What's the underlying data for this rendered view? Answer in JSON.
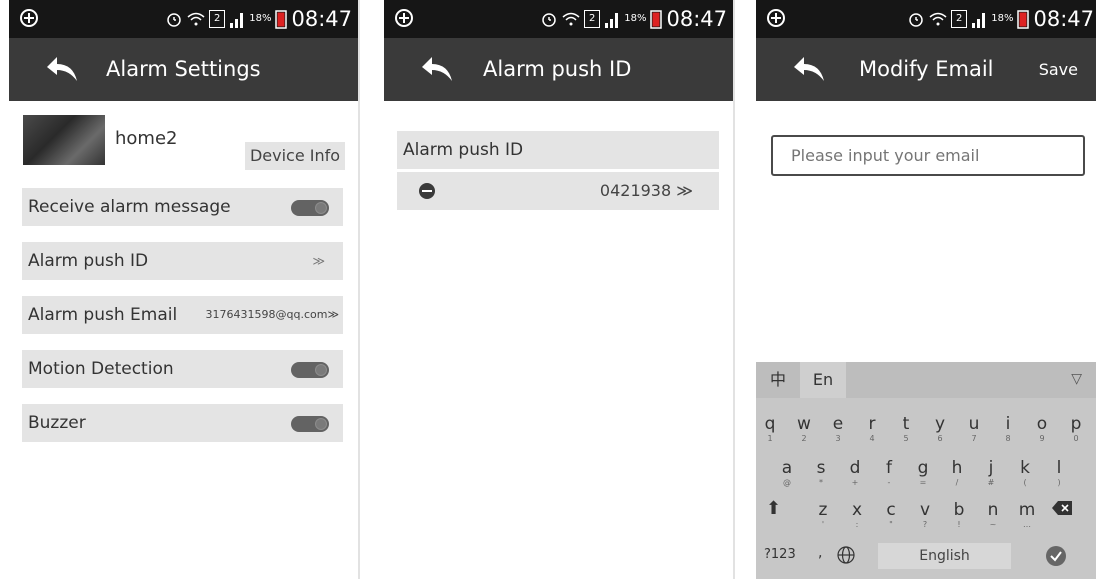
{
  "status_bar": {
    "battery": "18%",
    "time": "08:47",
    "sim": "2"
  },
  "screen1": {
    "title": "Alarm Settings",
    "device_name": "home2",
    "device_info_label": "Device Info",
    "rows": [
      {
        "label": "Receive alarm message",
        "toggle_on": true
      },
      {
        "label": "Alarm push ID",
        "value": "",
        "chevron": "≫"
      },
      {
        "label": "Alarm push Email",
        "value": "3176431598@qq.com≫"
      },
      {
        "label": "Motion Detection",
        "toggle_on": true
      },
      {
        "label": "Buzzer",
        "toggle_on": true
      }
    ]
  },
  "screen2": {
    "title": "Alarm push ID",
    "header_label": "Alarm push ID",
    "entry_value": "0421938 ≫"
  },
  "screen3": {
    "title": "Modify Email",
    "save_label": "Save",
    "email_placeholder": "Please input your email",
    "keyboard": {
      "lang_cn": "中",
      "lang_en": "En",
      "row1": [
        [
          "q",
          "1"
        ],
        [
          "w",
          "2"
        ],
        [
          "e",
          "3"
        ],
        [
          "r",
          "4"
        ],
        [
          "t",
          "5"
        ],
        [
          "y",
          "6"
        ],
        [
          "u",
          "7"
        ],
        [
          "i",
          "8"
        ],
        [
          "o",
          "9"
        ],
        [
          "p",
          "0"
        ]
      ],
      "row2": [
        [
          "a",
          "@"
        ],
        [
          "s",
          "*"
        ],
        [
          "d",
          "+"
        ],
        [
          "f",
          "-"
        ],
        [
          "g",
          "="
        ],
        [
          "h",
          "/"
        ],
        [
          "j",
          "#"
        ],
        [
          "k",
          "("
        ],
        [
          "l",
          ")"
        ]
      ],
      "row3": [
        [
          "z",
          "'"
        ],
        [
          "x",
          ":"
        ],
        [
          "c",
          "\""
        ],
        [
          "v",
          "?"
        ],
        [
          "b",
          "!"
        ],
        [
          "n",
          "~"
        ],
        [
          "m",
          "…"
        ]
      ],
      "mode_label": "?123",
      "comma": ",",
      "space_label": "English"
    }
  }
}
